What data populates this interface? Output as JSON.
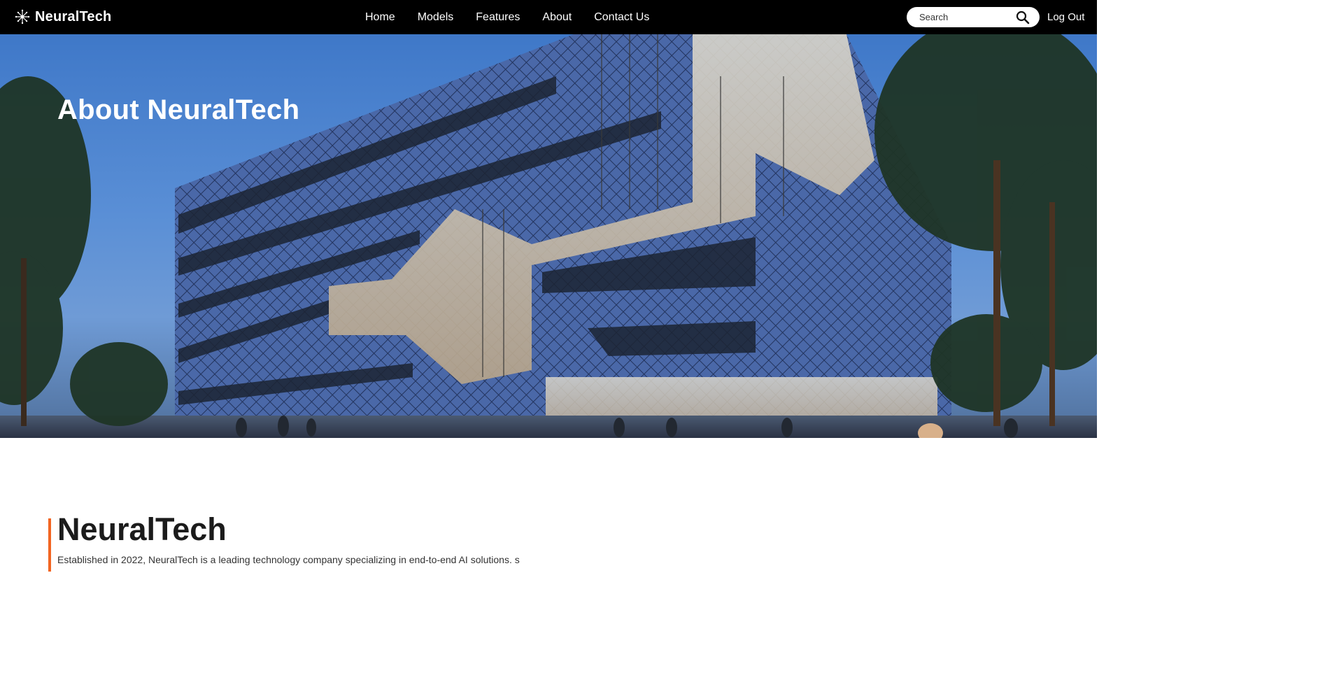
{
  "nav": {
    "brand": "NeuralTech",
    "links": [
      "Home",
      "Models",
      "Features",
      "About",
      "Contact Us"
    ],
    "search_placeholder": "Search",
    "logout_label": "Log Out"
  },
  "hero": {
    "title": "About NeuralTech"
  },
  "about": {
    "heading": "NeuralTech",
    "description": "Established in 2022, NeuralTech is a leading technology company specializing in end-to-end AI solutions. s"
  },
  "colors": {
    "nav_bg": "#000000",
    "accent": "#f26522",
    "text_dark": "#1b1b1b"
  },
  "icons": {
    "brand": "neural-network-icon",
    "search": "search-icon"
  }
}
